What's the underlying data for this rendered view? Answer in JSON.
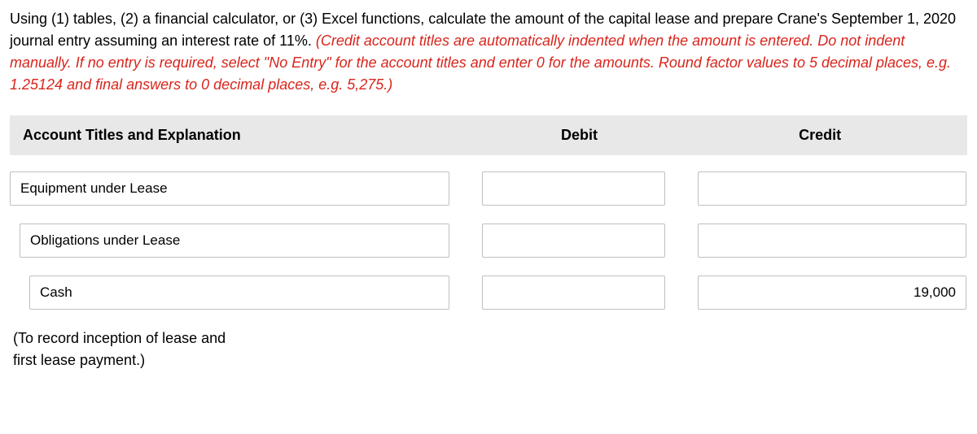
{
  "instruction": {
    "black": "Using (1) tables, (2) a financial calculator, or (3) Excel functions, calculate the amount of the capital lease and prepare Crane's September 1, 2020 journal entry assuming an interest rate of 11%. ",
    "red": "(Credit account titles are automatically indented when the amount is entered. Do not indent manually. If no entry is required, select \"No Entry\" for the account titles and enter 0 for the amounts. Round factor values to 5 decimal places, e.g. 1.25124 and final answers to 0 decimal places, e.g. 5,275.)"
  },
  "headers": {
    "account": "Account Titles and Explanation",
    "debit": "Debit",
    "credit": "Credit"
  },
  "rows": [
    {
      "account": "Equipment under Lease",
      "debit": "",
      "credit": ""
    },
    {
      "account": "Obligations under Lease",
      "debit": "",
      "credit": ""
    },
    {
      "account": "Cash",
      "debit": "",
      "credit": "19,000"
    }
  ],
  "note": "(To record inception of lease and first lease payment.)"
}
